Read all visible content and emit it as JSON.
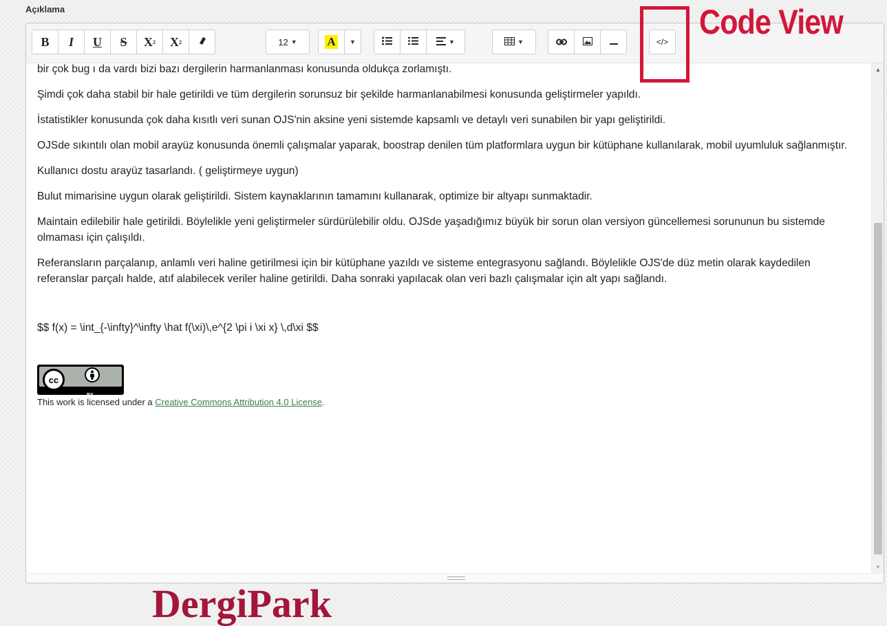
{
  "field": {
    "label": "Açıklama"
  },
  "toolbar": {
    "bold": "B",
    "italic": "I",
    "underline": "U",
    "strikethrough": "S",
    "superscript": "X",
    "subscript": "X",
    "fontsize": "12",
    "color_letter": "A",
    "code_view": "</>"
  },
  "icons": {
    "eraser": "eraser-icon",
    "unordered_list": "list-ul-icon",
    "ordered_list": "list-ol-icon",
    "align": "align-icon",
    "table": "table-icon",
    "link": "link-icon",
    "picture": "picture-icon",
    "hr": "horizontal-rule-icon",
    "code": "code-icon"
  },
  "content": {
    "paragraphs": [
      "bir çok bug ı da vardı bizi bazı dergilerin harmanlanması konusunda oldukça zorlamıştı.",
      "Şimdi çok daha stabil bir hale getirildi ve tüm dergilerin sorunsuz bir şekilde harmanlanabilmesi konusunda geliştirmeler yapıldı.",
      "İstatistikler konusunda çok daha kısıtlı veri sunan OJS'nin aksine yeni sistemde kapsamlı ve detaylı veri sunabilen bir yapı geliştirildi.",
      "OJSde sıkıntılı olan mobil arayüz konusunda önemli çalışmalar yaparak, boostrap denilen tüm platformlara uygun bir kütüphane kullanılarak, mobil uyumluluk sağlanmıştır.",
      "Kullanıcı dostu arayüz tasarlandı. ( geliştirmeye uygun)",
      "Bulut mimarisine uygun olarak geliştirildi. Sistem kaynaklarının tamamını kullanarak, optimize bir altyapı sunmaktadir.",
      "Maintain edilebilir hale getirildi. Böylelikle yeni geliştirmeler sürdürülebilir oldu. OJSde yaşadığımız büyük bir sorun olan versiyon güncellemesi sorununun bu sistemde olmaması için çalışıldı.",
      "Referansların parçalanıp, anlamlı veri haline getirilmesi için bir kütüphane yazıldı ve sisteme entegrasyonu sağlandı. Böylelikle OJS'de düz metin olarak kaydedilen referanslar parçalı halde, atıf alabilecek veriler haline getirildi. Daha sonraki yapılacak olan veri bazlı çalışmalar için alt yapı sağlandı."
    ],
    "formula": "$$ f(x) = \\int_{-\\infty}^\\infty \\hat f(\\xi)\\,e^{2 \\pi i \\xi x} \\,d\\xi $$",
    "license_prefix": "This work is licensed under a ",
    "license_link": "Creative Commons Attribution 4.0 License",
    "license_suffix": ".",
    "badge_cc": "cc",
    "badge_by": "BY"
  },
  "annotations": {
    "code_view_label": "Code View",
    "brand": "DergiPark",
    "color": "#d3163a"
  }
}
